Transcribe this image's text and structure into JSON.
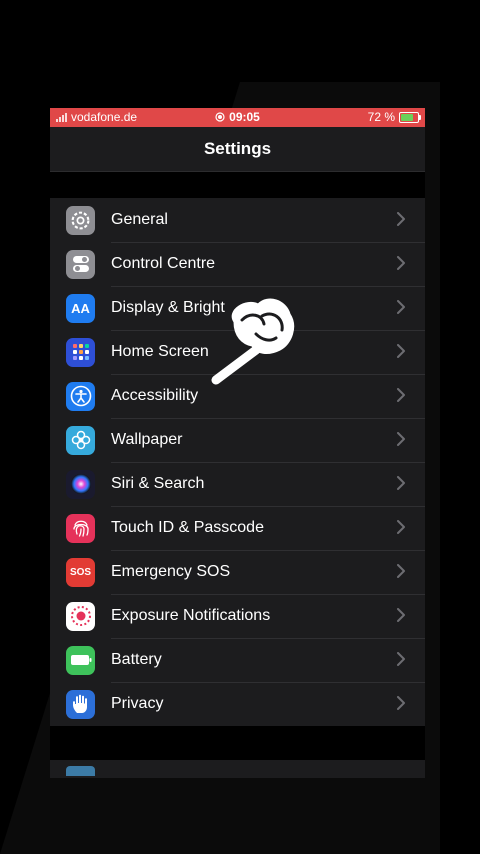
{
  "status_bar": {
    "carrier": "vodafone.de",
    "time": "09:05",
    "battery_percent": "72 %",
    "battery_level": 0.72
  },
  "nav": {
    "title": "Settings"
  },
  "settings_items": [
    {
      "label": "General",
      "icon": "gear-icon",
      "color": "#8e8e93"
    },
    {
      "label": "Control Centre",
      "icon": "toggles-icon",
      "color": "#8e8e93"
    },
    {
      "label": "Display & Bright",
      "icon": "display-aa-icon",
      "color": "#1f7cf0"
    },
    {
      "label": "Home Screen",
      "icon": "home-grid-icon",
      "color": "#2e4fd6"
    },
    {
      "label": "Accessibility",
      "icon": "accessibility-icon",
      "color": "#1f7cf0"
    },
    {
      "label": "Wallpaper",
      "icon": "flower-icon",
      "color": "#36aadc"
    },
    {
      "label": "Siri & Search",
      "icon": "siri-icon",
      "color": "#1a1a2e"
    },
    {
      "label": "Touch ID & Passcode",
      "icon": "fingerprint-icon",
      "color": "#e5325a"
    },
    {
      "label": "Emergency SOS",
      "icon": "sos-icon",
      "color": "#e23b34"
    },
    {
      "label": "Exposure Notifications",
      "icon": "exposure-icon",
      "color": "#ffffff"
    },
    {
      "label": "Battery",
      "icon": "battery-icon",
      "color": "#3ec25b"
    },
    {
      "label": "Privacy",
      "icon": "hand-icon",
      "color": "#2c6fd8"
    }
  ],
  "sos_text": "SOS",
  "aa_text": "AA"
}
